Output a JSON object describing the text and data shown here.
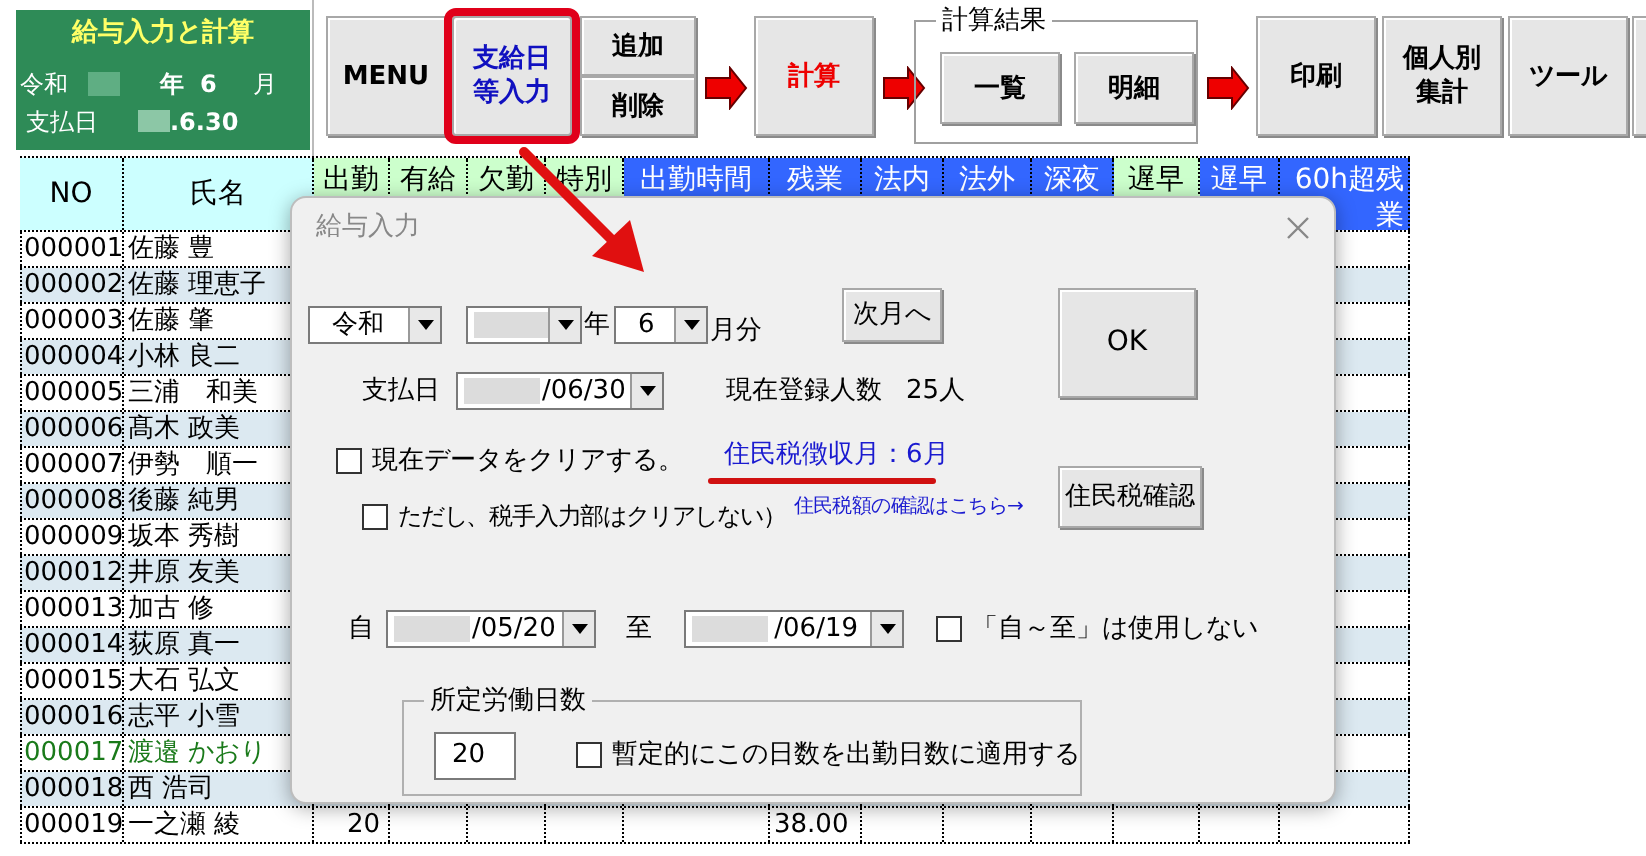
{
  "summary_panel": {
    "title": "給与入力と計算",
    "era": "令和",
    "year_redacted": true,
    "year_unit": "年",
    "month": "6",
    "month_unit": "月",
    "pay_date_label": "支払日",
    "pay_date_redacted": true,
    "pay_date": ".6.30"
  },
  "toolbar": [
    {
      "kind": "button",
      "label": "MENU",
      "color": "#000000",
      "highlighted": false
    },
    {
      "kind": "button",
      "label": "支給日等入力",
      "color": "#1010c0",
      "highlighted": true
    },
    {
      "kind": "pair",
      "labels": [
        "追加",
        "削除"
      ]
    },
    {
      "kind": "arrow"
    },
    {
      "kind": "button",
      "label": "計算",
      "color": "#ee0000",
      "highlighted": false
    },
    {
      "kind": "arrow"
    },
    {
      "kind": "group",
      "title": "計算結果",
      "buttons": [
        "一覧",
        "明細"
      ]
    },
    {
      "kind": "arrow"
    },
    {
      "kind": "button",
      "label": "印刷",
      "color": "#000000",
      "highlighted": false
    },
    {
      "kind": "button",
      "label": "個人別集計",
      "color": "#000000",
      "highlighted": false
    },
    {
      "kind": "button",
      "label": "ツール",
      "color": "#000000",
      "highlighted": false
    },
    {
      "kind": "partial"
    }
  ],
  "columns": [
    {
      "label": "NO",
      "color": "#ccffff"
    },
    {
      "label": "氏名",
      "color": "#ccffff"
    },
    {
      "label": "出勤",
      "color": "#ccffcc"
    },
    {
      "label": "有給",
      "color": "#ccffcc"
    },
    {
      "label": "欠勤",
      "color": "#ccffcc"
    },
    {
      "label": "特別",
      "color": "#ccffcc"
    },
    {
      "label": "出勤時間",
      "color": "#3366ff"
    },
    {
      "label": "残業",
      "color": "#3366ff"
    },
    {
      "label": "法内",
      "color": "#3366ff"
    },
    {
      "label": "法外",
      "color": "#3366ff"
    },
    {
      "label": "深夜",
      "color": "#3366ff"
    },
    {
      "label": "遅早",
      "color": "#ccffcc"
    },
    {
      "label": "遅早",
      "color": "#3366ff"
    },
    {
      "label": "60h超残業",
      "color": "#3366ff"
    }
  ],
  "rows": [
    {
      "no": "000001",
      "name": "佐藤 豊",
      "color": "#000000"
    },
    {
      "no": "000002",
      "name": "佐藤 理恵子",
      "color": "#000000"
    },
    {
      "no": "000003",
      "name": "佐藤 肇",
      "color": "#000000"
    },
    {
      "no": "000004",
      "name": "小林 良二",
      "color": "#000000"
    },
    {
      "no": "000005",
      "name": "三浦　和美",
      "color": "#000000"
    },
    {
      "no": "000006",
      "name": "髙木 政美",
      "color": "#000000"
    },
    {
      "no": "000007",
      "name": "伊勢　順一",
      "color": "#000000"
    },
    {
      "no": "000008",
      "name": "後藤 純男",
      "color": "#000000"
    },
    {
      "no": "000009",
      "name": "坂本 秀樹",
      "color": "#000000"
    },
    {
      "no": "000012",
      "name": "井原 友美",
      "color": "#000000"
    },
    {
      "no": "000013",
      "name": "加古 修",
      "color": "#000000"
    },
    {
      "no": "000014",
      "name": "荻原 真一",
      "color": "#000000"
    },
    {
      "no": "000015",
      "name": "大石 弘文",
      "color": "#000000"
    },
    {
      "no": "000016",
      "name": "志平 小雪",
      "color": "#000000"
    },
    {
      "no": "000017",
      "name": "渡邉 かおり",
      "color": "#1a7a1a"
    },
    {
      "no": "000018",
      "name": "西 浩司",
      "color": "#000000"
    },
    {
      "no": "000019",
      "name": "一之瀬 綾",
      "color": "#000000",
      "attendance": "20",
      "overtime": "38.00"
    }
  ],
  "dialog": {
    "title": "給与入力",
    "era": {
      "value": "令和"
    },
    "year": {
      "redacted": true
    },
    "year_unit": "年",
    "month": {
      "value": "6"
    },
    "month_unit": "月分",
    "next_month_button": "次月へ",
    "ok_button": "OK",
    "pay_date_label": "支払日",
    "pay_date": {
      "value": "/06/30",
      "redacted": true
    },
    "registered_label": "現在登録人数",
    "registered_count": "25人",
    "clear_data": {
      "label": "現在データをクリアする。",
      "checked": false
    },
    "resident_tax_month": "住民税徴収月：6月",
    "keep_tax_input": {
      "label": "ただし、税手入力部はクリアしない）",
      "checked": false
    },
    "resident_tax_hint": "住民税額の確認はこちら→",
    "resident_tax_button": "住民税確認",
    "from_label": "自",
    "from_date": {
      "value": "/05/20",
      "redacted": true
    },
    "to_label": "至",
    "to_date": {
      "value": "/06/19",
      "redacted": true
    },
    "no_range": {
      "label": "「自～至」は使用しない",
      "checked": false
    },
    "workdays_group": {
      "title": "所定労働日数",
      "value": "20",
      "apply": {
        "label": "暫定的にこの日数を出勤日数に適用する",
        "checked": false
      }
    }
  }
}
